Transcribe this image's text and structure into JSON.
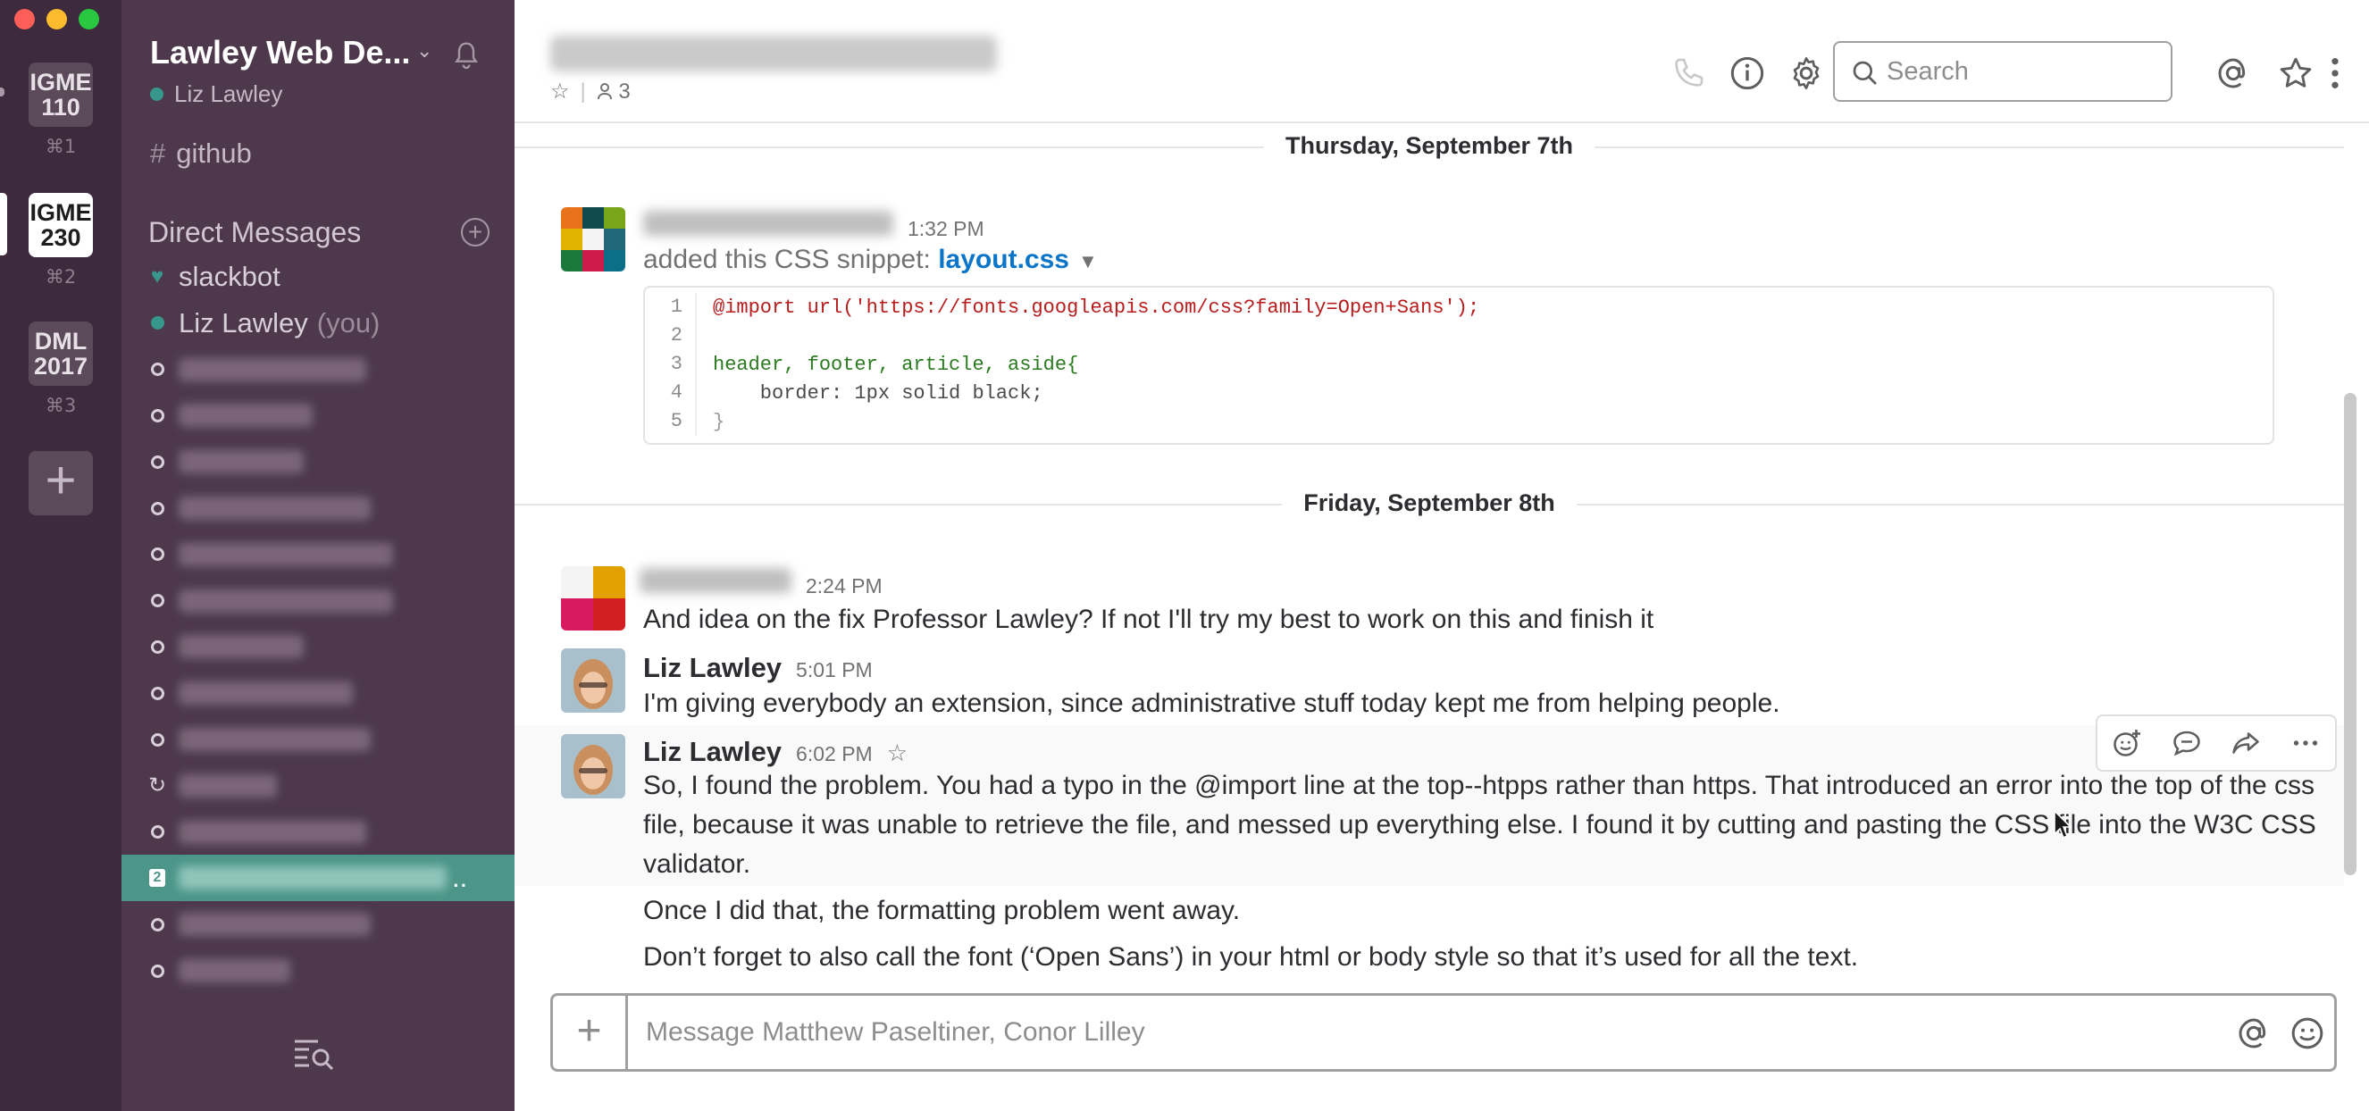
{
  "window": {
    "buttons": [
      "close",
      "minimize",
      "zoom"
    ]
  },
  "teams": [
    {
      "line1": "IGME",
      "line2": "110",
      "shortcut": "⌘1",
      "active": false
    },
    {
      "line1": "IGME",
      "line2": "230",
      "shortcut": "⌘2",
      "active": true
    },
    {
      "line1": "DML",
      "line2": "2017",
      "shortcut": "⌘3",
      "active": false
    }
  ],
  "sidebar": {
    "team_name": "Lawley Web De...",
    "user_name": "Liz Lawley",
    "channel": {
      "hash": "#",
      "name": "github"
    },
    "dm_header": "Direct Messages",
    "dms": [
      {
        "name": "slackbot",
        "marker": "heart"
      },
      {
        "name": "Liz Lawley",
        "suffix": "(you)",
        "marker": "online"
      },
      {
        "marker": "hollow",
        "blurred": true
      },
      {
        "marker": "hollow",
        "blurred": true
      },
      {
        "marker": "hollow",
        "blurred": true
      },
      {
        "marker": "hollow",
        "blurred": true
      },
      {
        "marker": "hollow",
        "blurred": true
      },
      {
        "marker": "hollow",
        "blurred": true
      },
      {
        "marker": "hollow",
        "blurred": true
      },
      {
        "marker": "hollow",
        "blurred": true
      },
      {
        "marker": "hollow",
        "blurred": true
      },
      {
        "marker": "reload",
        "blurred": true
      },
      {
        "marker": "hollow",
        "blurred": true
      },
      {
        "marker": "badge",
        "badge": "2",
        "blurred": true,
        "selected": true
      },
      {
        "marker": "hollow",
        "blurred": true
      },
      {
        "marker": "hollow",
        "blurred": true
      }
    ]
  },
  "header": {
    "member_count": "3",
    "search_placeholder": "Search"
  },
  "messages": {
    "day1": "Thursday, September 7th",
    "snippet_msg": {
      "time": "1:32 PM",
      "action": "added this CSS snippet:",
      "file": "layout.css",
      "code": [
        {
          "n": "1",
          "text": "@import url('https://fonts.googleapis.com/css?family=Open+Sans');"
        },
        {
          "n": "2",
          "text": ""
        },
        {
          "n": "3",
          "text": "header, footer, article, aside{"
        },
        {
          "n": "4",
          "text": "    border: 1px solid black;"
        },
        {
          "n": "5",
          "text": "}"
        }
      ]
    },
    "day2": "Friday, September 8th",
    "msg2": {
      "time": "2:24 PM",
      "text": "And idea on the fix Professor Lawley? If not I'll try my best to work on this and finish it"
    },
    "msg3": {
      "author": "Liz Lawley",
      "time": "5:01 PM",
      "text": "I'm giving everybody an extension, since administrative stuff today kept me from helping people."
    },
    "msg4": {
      "author": "Liz Lawley",
      "time": "6:02 PM",
      "text": "So, I found the problem. You had  a typo in the @import line at the top--htpps rather than https. That introduced an error into the top of the css file, because it was unable to retrieve the file, and messed up everything else. I found it by cutting and pasting the CSS file into the W3C CSS validator.",
      "followup1": "Once I did that, the formatting problem went away.",
      "followup2": "Don’t forget to also call the font (‘Open Sans’) in your html or body style so that it’s used for  all the text."
    }
  },
  "composer": {
    "placeholder": "Message Matthew Paseltiner, Conor Lilley"
  },
  "colors": {
    "sidebar_bg": "#4d394b",
    "team_bar_bg": "#3e2a3d",
    "selected_dm": "#4c9689",
    "link": "#0b76c9",
    "online": "#38978d"
  }
}
